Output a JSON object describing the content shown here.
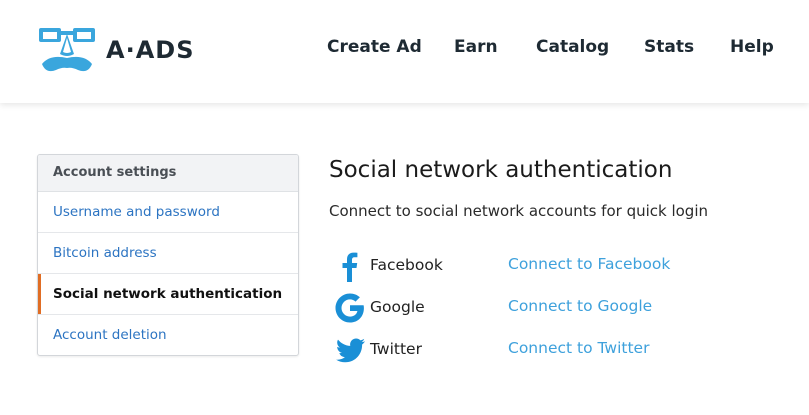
{
  "brand": {
    "name": "A·ADS",
    "logo_color": "#3aa6dd"
  },
  "nav": {
    "items": [
      "Create Ad",
      "Earn",
      "Catalog",
      "Stats",
      "Help"
    ]
  },
  "sidebar": {
    "heading": "Account settings",
    "items": [
      {
        "label": "Username and password"
      },
      {
        "label": "Bitcoin address"
      },
      {
        "label": "Social network authentication",
        "active": true
      },
      {
        "label": "Account deletion"
      }
    ],
    "active_accent": "#e06d24"
  },
  "main": {
    "title": "Social network authentication",
    "subtitle": "Connect to social network accounts for quick login",
    "providers": [
      {
        "name": "Facebook",
        "icon": "facebook-icon",
        "link": "Connect to Facebook"
      },
      {
        "name": "Google",
        "icon": "google-icon",
        "link": "Connect to Google"
      },
      {
        "name": "Twitter",
        "icon": "twitter-icon",
        "link": "Connect to Twitter"
      }
    ],
    "link_color": "#3ea1dc",
    "icon_color": "#1a8fd6"
  }
}
